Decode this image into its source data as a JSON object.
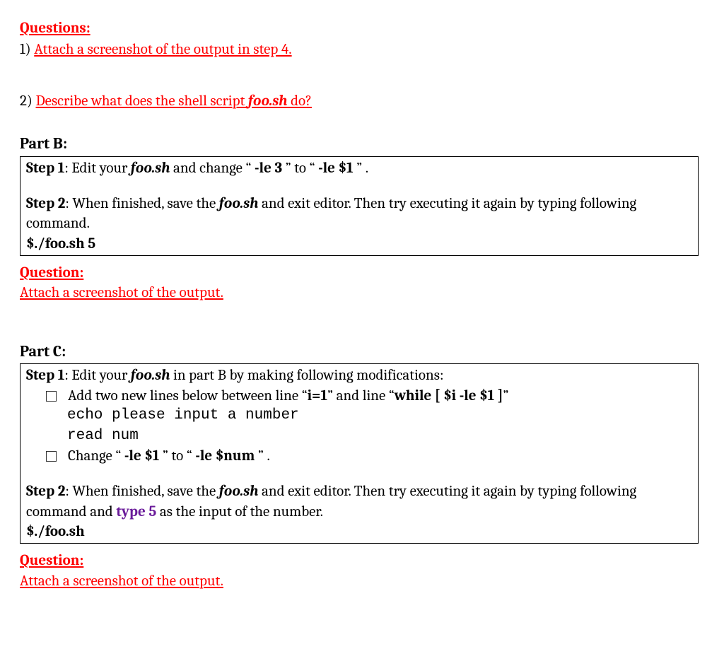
{
  "top": {
    "heading": "Questions:",
    "q1_num": "1) ",
    "q1_text": "Attach a screenshot of the output in step 4.",
    "q2_num": "2) ",
    "q2_prefix": "Describe what does the shell script ",
    "q2_script": "foo.sh",
    "q2_suffix": " do?"
  },
  "partB": {
    "title": "Part B:",
    "step1_label": "Step 1",
    "step1_a": ": Edit your ",
    "step1_script": "foo.sh",
    "step1_b": " and change “ ",
    "step1_code1": "-le 3",
    "step1_c": " ” to “  ",
    "step1_code2": "-le $1",
    "step1_d": " ” .",
    "step2_label": "Step 2",
    "step2_a": ": When finished, save the ",
    "step2_script": "foo.sh",
    "step2_b": " and exit editor. Then try executing it again by typing following command.",
    "cmd": "$./foo.sh 5",
    "question_heading": "Question:",
    "question_text": "Attach a screenshot of the output."
  },
  "partC": {
    "title": "Part C:",
    "step1_label": "Step 1",
    "step1_a": ": Edit your ",
    "step1_script": "foo.sh",
    "step1_b": " in part B by making following modifications:",
    "bullet1_a": "Add two new lines below between line “",
    "bullet1_code1": "i=1",
    "bullet1_b": "” and line “",
    "bullet1_code2": "while [ $i -le $1 ]",
    "bullet1_c": "”",
    "code_line1": "echo please input a number",
    "code_line2": "read num",
    "bullet2_a": "Change “ ",
    "bullet2_code1": "-le $1",
    "bullet2_b": " ” to “  ",
    "bullet2_code2": "-le $num",
    "bullet2_c": " ” .",
    "step2_label": "Step 2",
    "step2_a": ": When finished, save the ",
    "step2_script": "foo.sh",
    "step2_b": " and exit editor. Then try executing it again by typing following command and ",
    "step2_type5": "type 5",
    "step2_c": " as the input of the number.",
    "cmd": "$./foo.sh",
    "question_heading": "Question:",
    "question_text": "Attach a screenshot of the output."
  }
}
